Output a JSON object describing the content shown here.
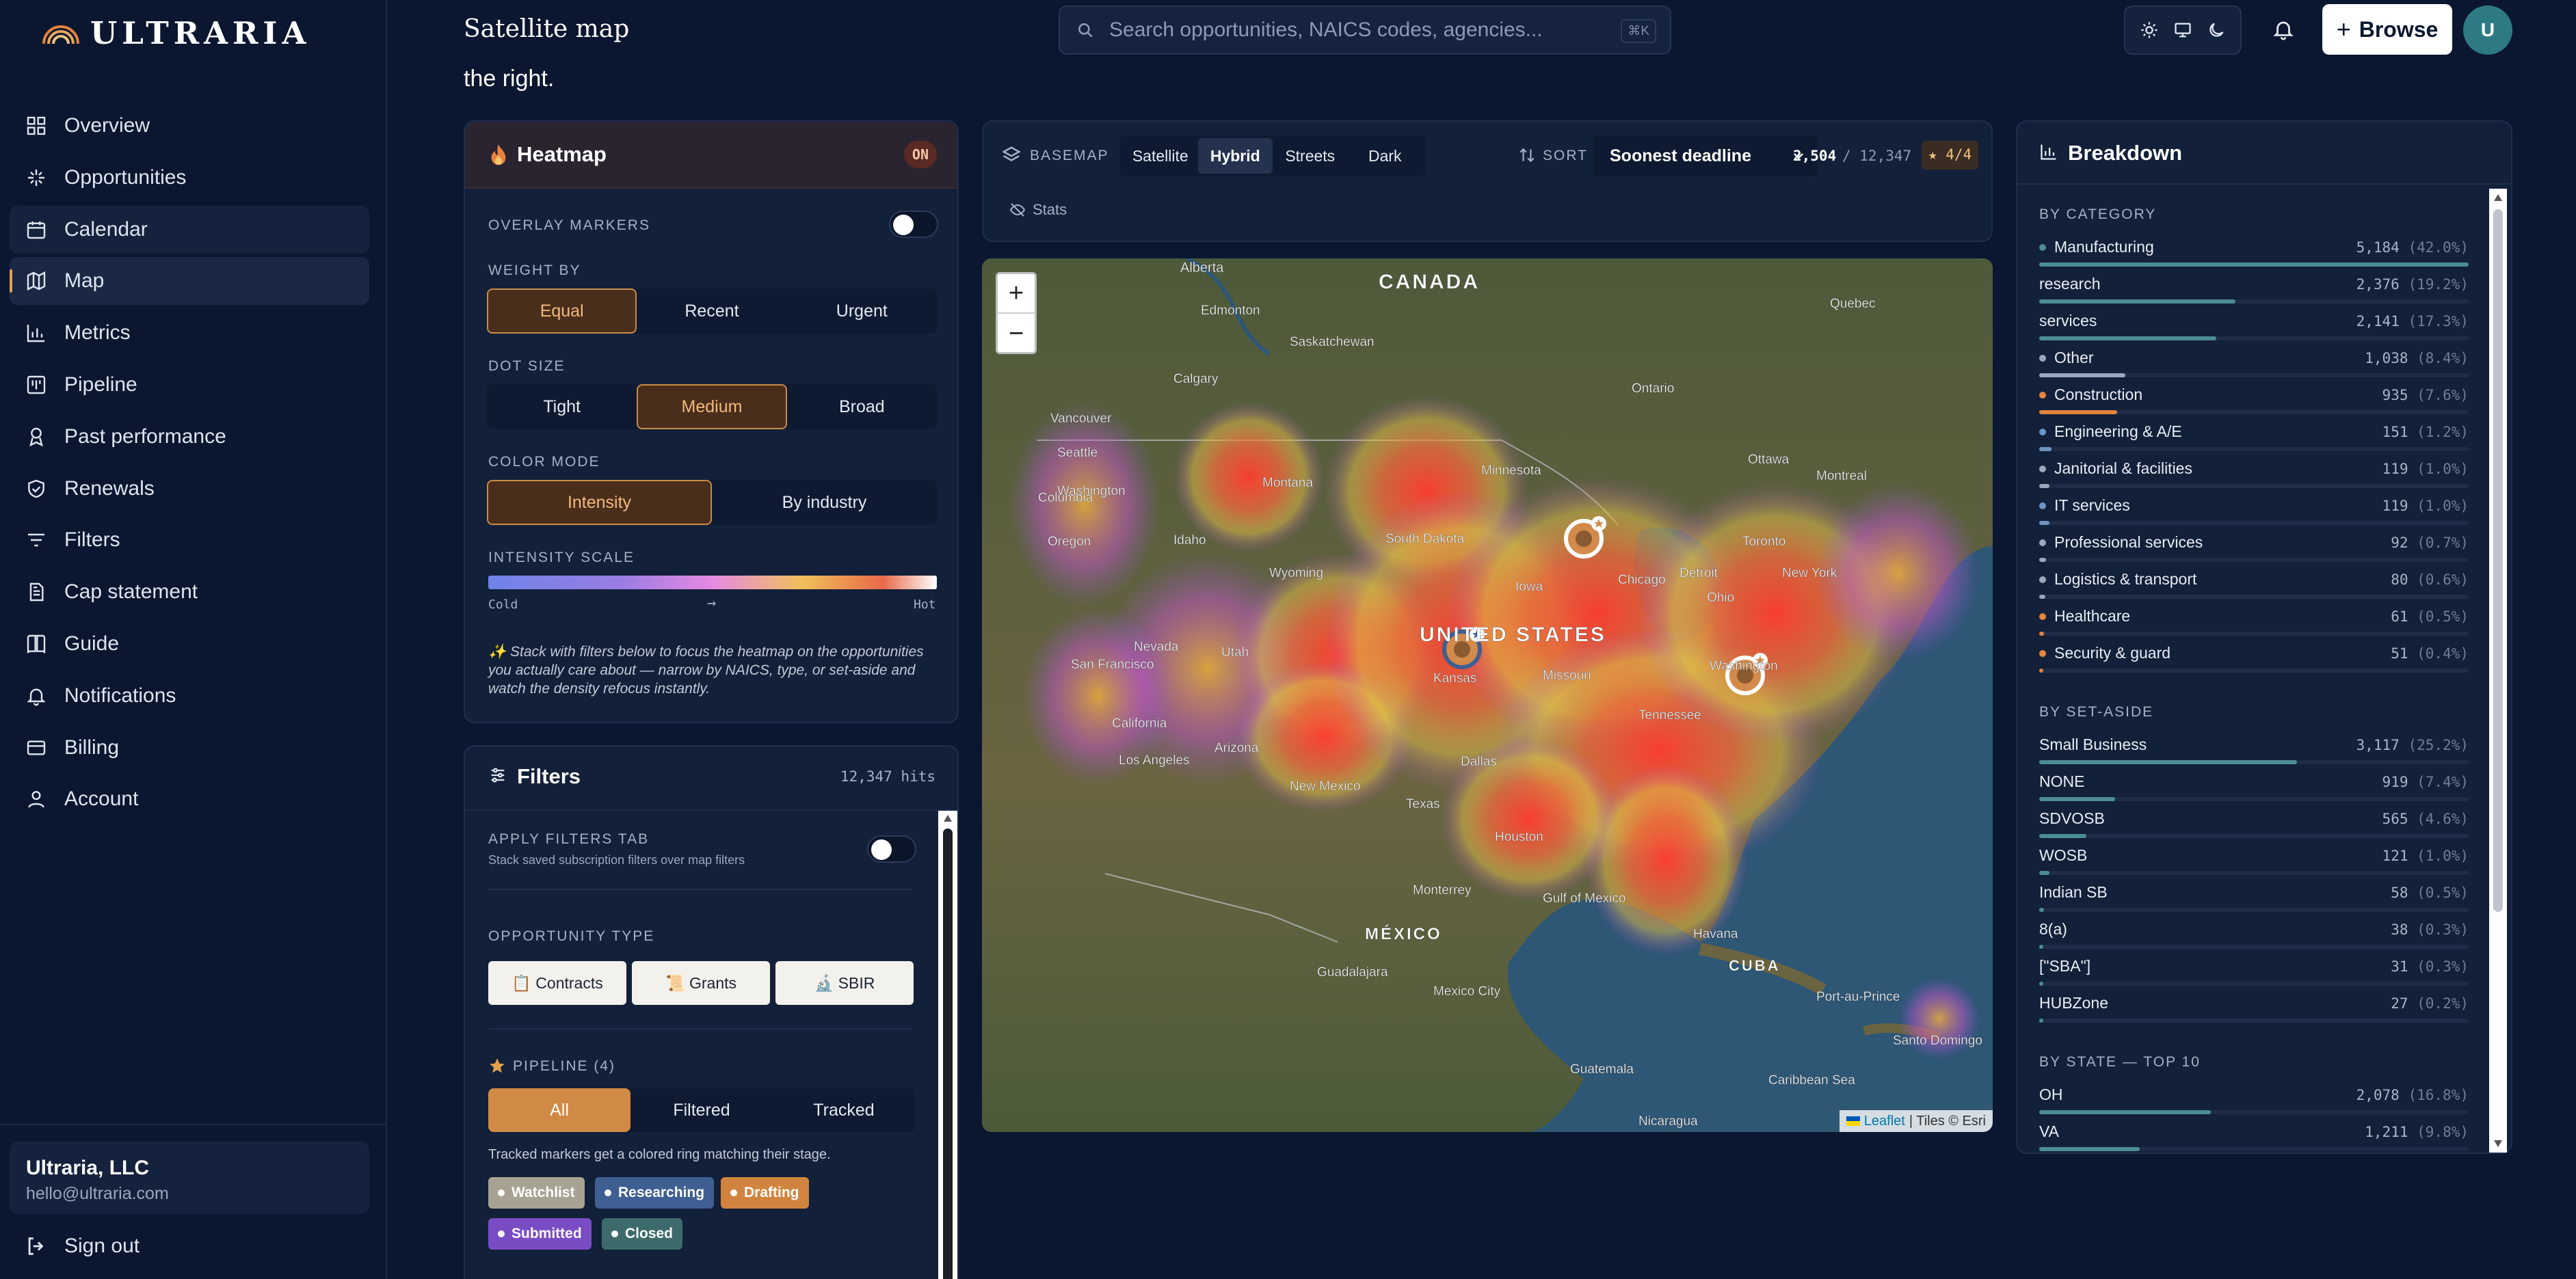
{
  "app": {
    "name": "ULTRARIA",
    "page_title": "Satellite map"
  },
  "search": {
    "placeholder": "Search opportunities, NAICS codes, agencies...",
    "shortcut": "⌘K"
  },
  "topbar": {
    "browse_label": "Browse",
    "avatar_initial": "U"
  },
  "intro_tail": "the right.",
  "sidebar": {
    "items": [
      {
        "label": "Overview",
        "icon": "grid-icon"
      },
      {
        "label": "Opportunities",
        "icon": "sparkle-icon"
      },
      {
        "label": "Calendar",
        "icon": "calendar-icon"
      },
      {
        "label": "Map",
        "icon": "map-icon"
      },
      {
        "label": "Metrics",
        "icon": "bar-chart-icon"
      },
      {
        "label": "Pipeline",
        "icon": "kanban-icon"
      },
      {
        "label": "Past performance",
        "icon": "award-icon"
      },
      {
        "label": "Renewals",
        "icon": "shield-check-icon"
      },
      {
        "label": "Filters",
        "icon": "filter-lines-icon"
      },
      {
        "label": "Cap statement",
        "icon": "document-icon"
      },
      {
        "label": "Guide",
        "icon": "book-icon"
      },
      {
        "label": "Notifications",
        "icon": "bell-icon"
      },
      {
        "label": "Billing",
        "icon": "credit-card-icon"
      },
      {
        "label": "Account",
        "icon": "user-icon"
      }
    ],
    "active": "Map",
    "org_name": "Ultraria, LLC",
    "org_email": "hello@ultraria.com",
    "signout_label": "Sign out"
  },
  "heatmap": {
    "title": "Heatmap",
    "status": "ON",
    "overlay_label": "OVERLAY MARKERS",
    "weight_label": "WEIGHT BY",
    "weight_options": [
      "Equal",
      "Recent",
      "Urgent"
    ],
    "weight_selected": "Equal",
    "dot_label": "DOT SIZE",
    "dot_options": [
      "Tight",
      "Medium",
      "Broad"
    ],
    "dot_selected": "Medium",
    "color_label": "COLOR MODE",
    "color_options": [
      "Intensity",
      "By industry"
    ],
    "color_selected": "Intensity",
    "scale_label": "INTENSITY SCALE",
    "scale_cold": "Cold",
    "scale_arrow": "→",
    "scale_hot": "Hot",
    "tip": "✨ Stack with filters below to focus the heatmap on the opportunities you actually care about — narrow by NAICS, type, or set-aside and watch the density refocus instantly."
  },
  "filters": {
    "title": "Filters",
    "hits": "12,347 hits",
    "apply_label": "APPLY FILTERS TAB",
    "apply_sub": "Stack saved subscription filters over map filters",
    "type_label": "OPPORTUNITY TYPE",
    "types": [
      "📋 Contracts",
      "📜 Grants",
      "🔬 SBIR"
    ],
    "pipeline_label": "PIPELINE (4)",
    "pipeline_options": [
      "All",
      "Filtered",
      "Tracked"
    ],
    "pipeline_selected": "All",
    "pipeline_note": "Tracked markers get a colored ring matching their stage.",
    "stages": [
      {
        "label": "Watchlist",
        "color": "#a8a293"
      },
      {
        "label": "Researching",
        "color": "#3f5f93"
      },
      {
        "label": "Drafting",
        "color": "#d1843f"
      },
      {
        "label": "Submitted",
        "color": "#7a4cc4"
      },
      {
        "label": "Closed",
        "color": "#3d6b6b"
      }
    ]
  },
  "map_toolbar": {
    "basemap_label": "BASEMAP",
    "basemaps": [
      "Satellite",
      "Hybrid",
      "Streets",
      "Dark"
    ],
    "basemap_selected": "Hybrid",
    "sort_label": "SORT",
    "sort_value": "Soonest deadline",
    "count_shown": "2,504",
    "count_total": "/ 12,347",
    "tracked": "★ 4/4",
    "stats_label": "Stats"
  },
  "map": {
    "zoom_in": "+",
    "zoom_out": "−",
    "attribution_leaflet": "Leaflet",
    "attribution_tiles": "| Tiles © Esri",
    "places": [
      "Alberta",
      "CANADA",
      "Edmonton",
      "Saskatchewan",
      "Quebec",
      "Calgary",
      "Ontario",
      "Vancouver",
      "Seattle",
      "Washington",
      "Montana",
      "Idaho",
      "Minnesota",
      "South Dakota",
      "Ottawa",
      "Montreal",
      "Toronto",
      "Detroit",
      "New York",
      "Chicago",
      "Wyoming",
      "Iowa",
      "Nevada",
      "Utah",
      "UNITED STATES",
      "Ohio",
      "San Francisco",
      "Kansas",
      "Missouri",
      "Washington",
      "California",
      "Arizona",
      "Tennessee",
      "Los Angeles",
      "New Mexico",
      "Dallas",
      "Texas",
      "Houston",
      "Monterrey",
      "Gulf of Mexico",
      "Havana",
      "MÉXICO",
      "CUBA",
      "Guadalajara",
      "Mexico City",
      "Port-au-Prince",
      "Santo Domingo",
      "Guatemala",
      "Caribbean Sea",
      "Nicaragua",
      "Oregon",
      "Columbia"
    ]
  },
  "breakdown": {
    "title": "Breakdown",
    "category_label": "BY CATEGORY",
    "categories": [
      {
        "label": "Manufacturing",
        "value": "5,184",
        "pct": "(42.0%)",
        "frac": 0.42,
        "dot": "#4c8c93"
      },
      {
        "label": "research",
        "value": "2,376",
        "pct": "(19.2%)",
        "frac": 0.192,
        "dot": ""
      },
      {
        "label": "services",
        "value": "2,141",
        "pct": "(17.3%)",
        "frac": 0.173,
        "dot": ""
      },
      {
        "label": "Other",
        "value": "1,038",
        "pct": "(8.4%)",
        "frac": 0.084,
        "dot": "#9aa7bd"
      },
      {
        "label": "Construction",
        "value": "935",
        "pct": "(7.6%)",
        "frac": 0.076,
        "dot": "#e3843f"
      },
      {
        "label": "Engineering & A/E",
        "value": "151",
        "pct": "(1.2%)",
        "frac": 0.012,
        "dot": "#6f94c2"
      },
      {
        "label": "Janitorial & facilities",
        "value": "119",
        "pct": "(1.0%)",
        "frac": 0.01,
        "dot": "#9aa7bd"
      },
      {
        "label": "IT services",
        "value": "119",
        "pct": "(1.0%)",
        "frac": 0.01,
        "dot": "#6f94c2"
      },
      {
        "label": "Professional services",
        "value": "92",
        "pct": "(0.7%)",
        "frac": 0.007,
        "dot": "#9aa7bd"
      },
      {
        "label": "Logistics & transport",
        "value": "80",
        "pct": "(0.6%)",
        "frac": 0.006,
        "dot": "#9aa7bd"
      },
      {
        "label": "Healthcare",
        "value": "61",
        "pct": "(0.5%)",
        "frac": 0.005,
        "dot": "#e3843f"
      },
      {
        "label": "Security & guard",
        "value": "51",
        "pct": "(0.4%)",
        "frac": 0.004,
        "dot": "#e3843f"
      }
    ],
    "setaside_label": "BY SET-ASIDE",
    "setasides": [
      {
        "label": "Small Business",
        "value": "3,117",
        "pct": "(25.2%)",
        "frac": 0.252
      },
      {
        "label": "NONE",
        "value": "919",
        "pct": "(7.4%)",
        "frac": 0.074
      },
      {
        "label": "SDVOSB",
        "value": "565",
        "pct": "(4.6%)",
        "frac": 0.046
      },
      {
        "label": "WOSB",
        "value": "121",
        "pct": "(1.0%)",
        "frac": 0.01
      },
      {
        "label": "Indian SB",
        "value": "58",
        "pct": "(0.5%)",
        "frac": 0.005
      },
      {
        "label": "8(a)",
        "value": "38",
        "pct": "(0.3%)",
        "frac": 0.003
      },
      {
        "label": "[\"SBA\"]",
        "value": "31",
        "pct": "(0.3%)",
        "frac": 0.003
      },
      {
        "label": "HUBZone",
        "value": "27",
        "pct": "(0.2%)",
        "frac": 0.002
      }
    ],
    "state_label": "BY STATE — TOP 10",
    "states": [
      {
        "label": "OH",
        "value": "2,078",
        "pct": "(16.8%)",
        "frac": 0.168
      },
      {
        "label": "VA",
        "value": "1,211",
        "pct": "(9.8%)",
        "frac": 0.098
      }
    ]
  },
  "colors": {
    "accent": "#e3a04f",
    "bg": "#0b1730",
    "panel": "#122039",
    "bar": "#4c8c93"
  }
}
